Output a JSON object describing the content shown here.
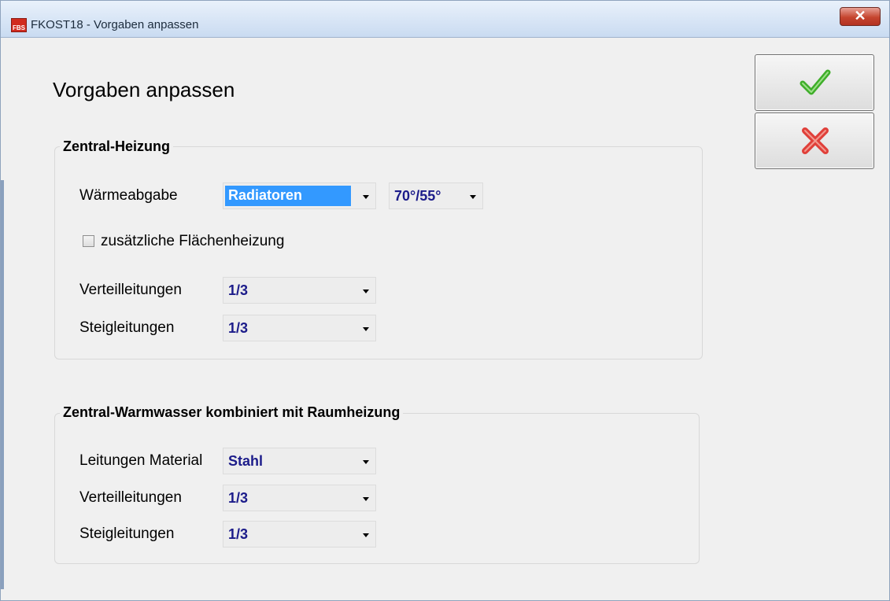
{
  "window": {
    "title": "FKOST18 - Vorgaben anpassen",
    "icon_text": "FBS",
    "close_glyph": "✕"
  },
  "heading": "Vorgaben anpassen",
  "zentral_heizung": {
    "title": "Zentral-Heizung",
    "waermeabgabe": {
      "label": "Wärmeabgabe",
      "value": "Radiatoren",
      "temp_value": "70°/55°"
    },
    "flaechenheizung": {
      "label": "zusätzliche Flächenheizung",
      "checked": false
    },
    "verteilleitungen": {
      "label": "Verteilleitungen",
      "value": "1/3"
    },
    "steigleitungen": {
      "label": "Steigleitungen",
      "value": "1/3"
    }
  },
  "zentral_warmwasser": {
    "title": "Zentral-Warmwasser kombiniert mit Raumheizung",
    "leitungen_material": {
      "label": "Leitungen Material",
      "value": "Stahl"
    },
    "verteilleitungen": {
      "label": "Verteilleitungen",
      "value": "1/3"
    },
    "steigleitungen": {
      "label": "Steigleitungen",
      "value": "1/3"
    }
  },
  "buttons": {
    "ok_icon": "checkmark-icon",
    "cancel_icon": "cross-icon"
  },
  "colors": {
    "value_text": "#1c1c8a",
    "selection": "#3399ff",
    "ok": "#3fae2a",
    "cancel": "#e0403a"
  }
}
